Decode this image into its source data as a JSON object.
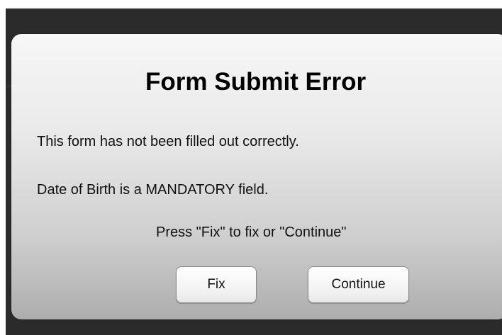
{
  "dialog": {
    "title": "Form Submit Error",
    "message_line_1": "This form has not been filled out correctly.",
    "message_line_2": "Date of Birth is a MANDATORY field.",
    "instruction": "Press \"Fix\" to fix or \"Continue\""
  },
  "buttons": {
    "fix_label": "Fix",
    "continue_label": "Continue"
  },
  "colors": {
    "backdrop": "#2b2b2b",
    "dialog_top": "#f7f7f7",
    "dialog_bottom": "#adadad",
    "text": "#000000"
  }
}
